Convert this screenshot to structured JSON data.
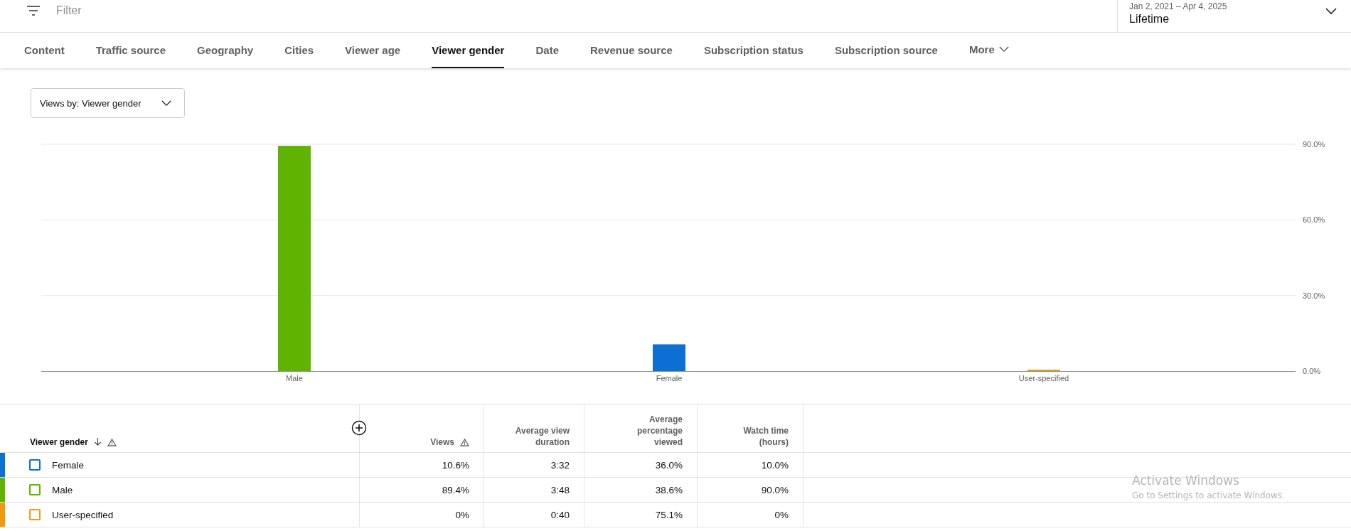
{
  "filter_bar": {
    "placeholder": "Filter"
  },
  "date_picker": {
    "range": "Jan 2, 2021 – Apr 4, 2025",
    "value": "Lifetime"
  },
  "tabs": [
    {
      "label": "Content",
      "selected": false
    },
    {
      "label": "Traffic source",
      "selected": false
    },
    {
      "label": "Geography",
      "selected": false
    },
    {
      "label": "Cities",
      "selected": false
    },
    {
      "label": "Viewer age",
      "selected": false
    },
    {
      "label": "Viewer gender",
      "selected": true
    },
    {
      "label": "Date",
      "selected": false
    },
    {
      "label": "Revenue source",
      "selected": false
    },
    {
      "label": "Subscription status",
      "selected": false
    },
    {
      "label": "Subscription source",
      "selected": false
    }
  ],
  "more_tab": {
    "label": "More"
  },
  "metric_dropdown": {
    "value": "Views by: Viewer gender"
  },
  "chart": {
    "bars": [
      {
        "color": "#60b300"
      },
      {
        "color": "#0b6fd4"
      },
      {
        "color": "#f29a0f"
      }
    ],
    "chart_data": {
      "type": "bar",
      "categories": [
        "Male",
        "Female",
        "User-specified"
      ],
      "values": [
        89.4,
        10.6,
        0
      ],
      "ylim": [
        0,
        90
      ],
      "yticks": [
        {
          "value": 0,
          "label": "0.0%"
        },
        {
          "value": 30,
          "label": "30.0%"
        },
        {
          "value": 60,
          "label": "60.0%"
        },
        {
          "value": 90,
          "label": "90.0%"
        }
      ]
    }
  },
  "table": {
    "columns": [
      "Viewer gender",
      "Views",
      "Average view duration",
      "Average percentage viewed",
      "Watch time (hours)"
    ],
    "rows": [
      {
        "color": "#0b6fd4",
        "checked": false,
        "cells": [
          "Female",
          "10.6%",
          "3:32",
          "36.0%",
          "10.0%"
        ]
      },
      {
        "color": "#60b300",
        "checked": false,
        "cells": [
          "Male",
          "89.4%",
          "3:48",
          "38.6%",
          "90.0%"
        ]
      },
      {
        "color": "#f29a0f",
        "checked": false,
        "cells": [
          "User-specified",
          "0%",
          "0:40",
          "75.1%",
          "0%"
        ]
      }
    ]
  },
  "os_overlay": {
    "title": "Activate Windows",
    "subtitle": "Go to Settings to activate Windows."
  }
}
